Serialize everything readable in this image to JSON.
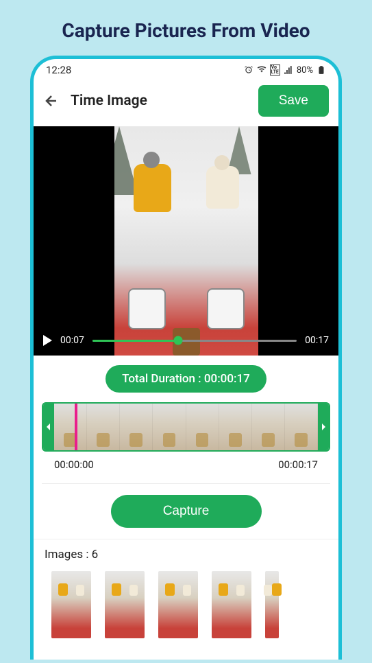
{
  "page": {
    "title": "Capture Pictures From Video"
  },
  "status_bar": {
    "time": "12:28",
    "battery": "80%"
  },
  "app_bar": {
    "title": "Time Image",
    "save_label": "Save"
  },
  "video": {
    "current_time": "00:07",
    "total_time": "00:17",
    "progress_percent": 42
  },
  "duration": {
    "label": "Total Duration : 00:00:17"
  },
  "timeline": {
    "start_label": "00:00:00",
    "end_label": "00:00:17",
    "frame_count": 8
  },
  "capture": {
    "button_label": "Capture"
  },
  "images": {
    "label": "Images : 6",
    "count": 6,
    "visible_thumbs": 4
  }
}
